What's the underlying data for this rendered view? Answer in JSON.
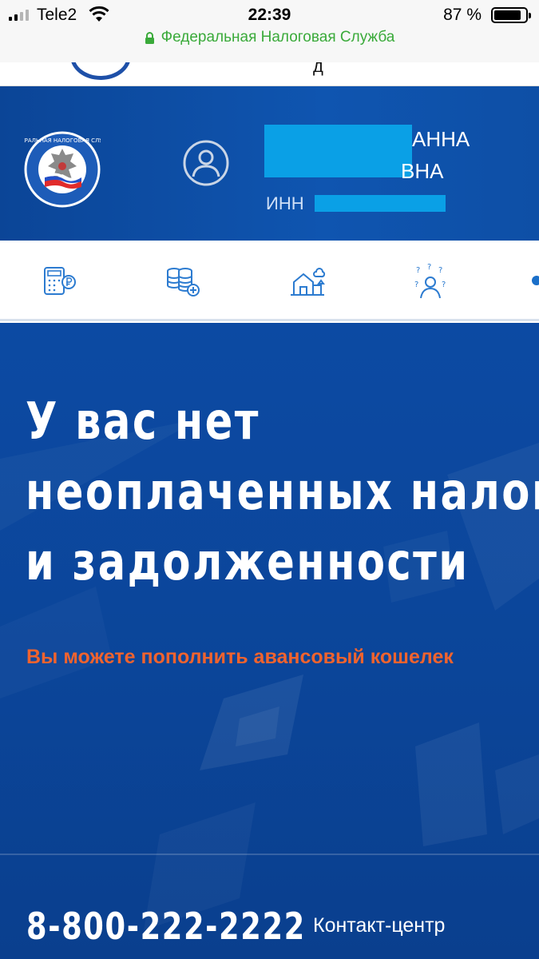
{
  "status_bar": {
    "carrier": "Tele2",
    "time": "22:39",
    "battery_percent_label": "87 %",
    "battery_level": 0.87,
    "site_name": "Федеральная Налоговая Служба"
  },
  "header": {
    "name_line1": "АННА",
    "name_line2": "ВНА",
    "inn_label": "ИНН"
  },
  "nav": {
    "icons": [
      "calculator-ruble-icon",
      "coins-add-icon",
      "property-icon",
      "questions-person-icon"
    ]
  },
  "main": {
    "headline_lines": [
      "У вас нет",
      "неоплаченных налогов",
      "и задолженности"
    ],
    "subtitle": "Вы можете пополнить авансовый кошелек",
    "phone": "8-800-222-2222",
    "contact_label": "Контакт-центр"
  },
  "colors": {
    "header_blue": "#0f55b0",
    "main_blue": "#0b4599",
    "accent_orange": "#f0632e",
    "url_green": "#3aaa3a",
    "mask_blue": "#0aa0e6"
  }
}
